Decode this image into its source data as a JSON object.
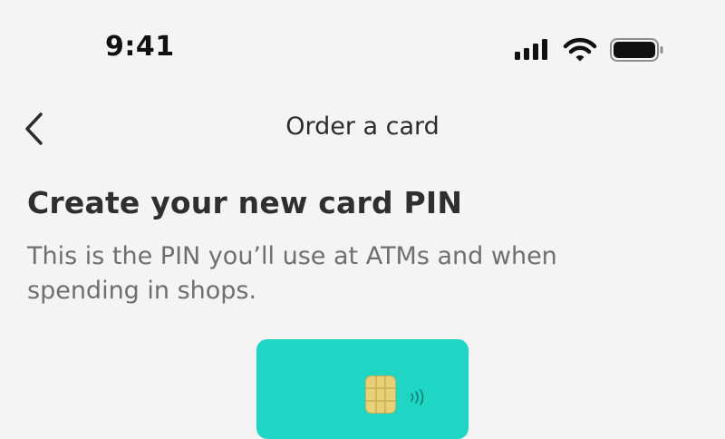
{
  "status_bar": {
    "time": "9:41",
    "icons": [
      "cellular-signal-icon",
      "wifi-icon",
      "battery-icon"
    ]
  },
  "nav": {
    "back_icon": "chevron-left-icon",
    "title": "Order a card"
  },
  "main": {
    "heading": "Create your new card PIN",
    "description": "This is the PIN you’ll use at ATMs and when spending in shops."
  },
  "card": {
    "color": "#1fd5c4",
    "chip_icon": "card-chip-icon",
    "contactless_icon": "contactless-icon"
  }
}
